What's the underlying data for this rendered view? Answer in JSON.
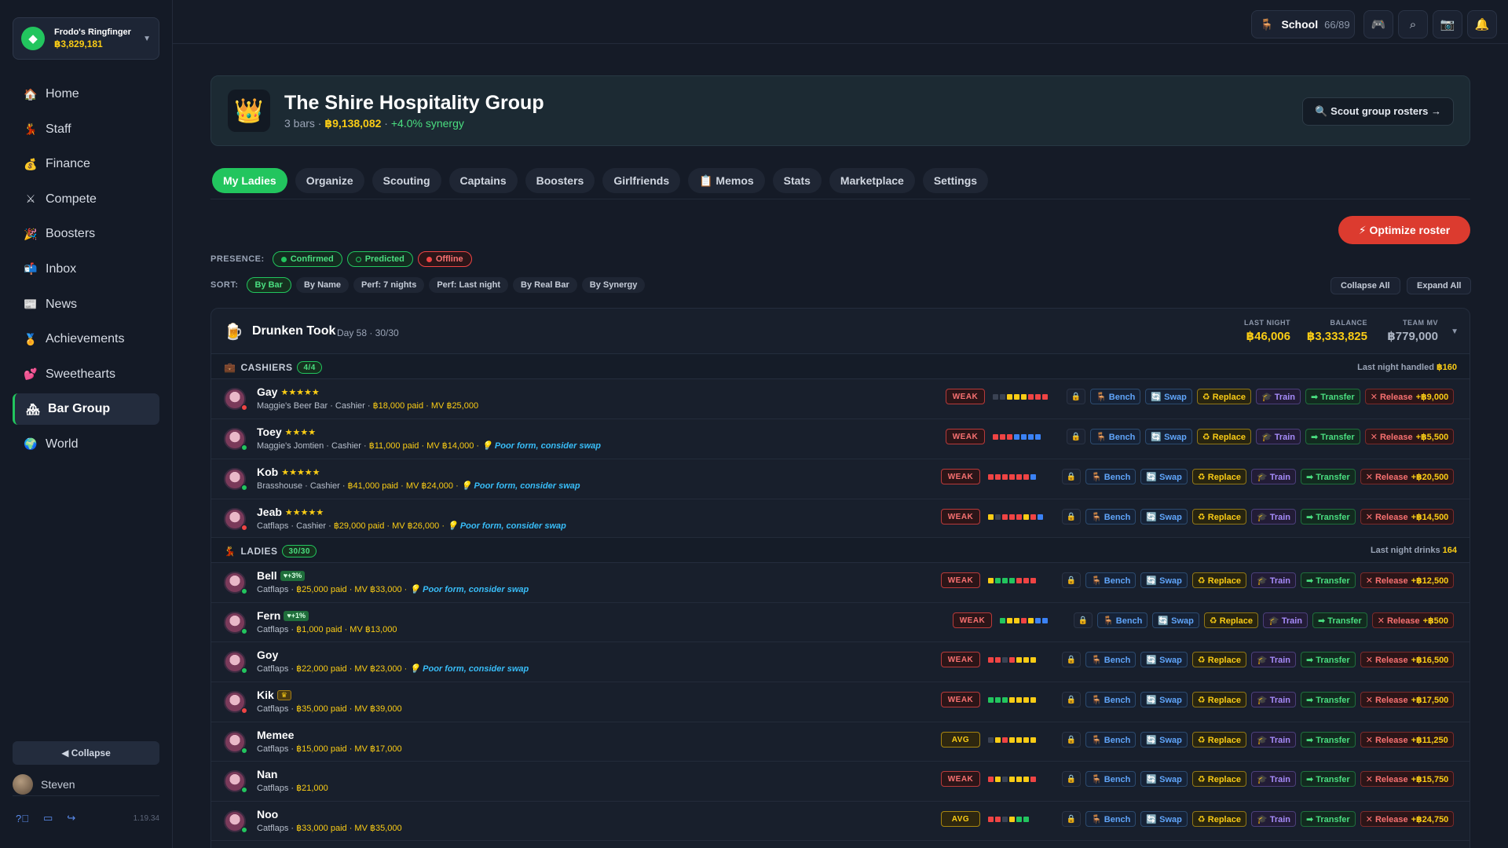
{
  "account": {
    "name": "Frodo's Ringfinger",
    "balance": "฿3,829,181"
  },
  "nav": [
    {
      "icon": "🏠",
      "label": "Home",
      "name": "home-icon"
    },
    {
      "icon": "💃",
      "label": "Staff",
      "name": "staff-icon"
    },
    {
      "icon": "💰",
      "label": "Finance",
      "name": "money-bag-icon"
    },
    {
      "icon": "⚔",
      "label": "Compete",
      "name": "swords-icon"
    },
    {
      "icon": "🎉",
      "label": "Boosters",
      "name": "party-popper-icon"
    },
    {
      "icon": "📬",
      "label": "Inbox",
      "name": "mailbox-icon"
    },
    {
      "icon": "📰",
      "label": "News",
      "name": "newspaper-icon"
    },
    {
      "icon": "🏅",
      "label": "Achievements",
      "name": "medal-icon"
    },
    {
      "icon": "💕",
      "label": "Sweethearts",
      "name": "hearts-icon"
    },
    {
      "icon": "🏘",
      "label": "Bar Group",
      "name": "houses-icon",
      "active": true
    },
    {
      "icon": "🌍",
      "label": "World",
      "name": "globe-icon"
    }
  ],
  "sidebar": {
    "collapse_label": "◀ Collapse",
    "user_name": "Steven",
    "version": "1.19.34"
  },
  "topbar": {
    "school_label": "School",
    "school_count": "66/89"
  },
  "group": {
    "title": "The Shire Hospitality Group",
    "bars_count": "3 bars",
    "balance": "฿9,138,082",
    "synergy": "+4.0% synergy",
    "scout_label": "🔍 Scout group rosters →"
  },
  "tabs": [
    "My Ladies",
    "Organize",
    "Scouting",
    "Captains",
    "Boosters",
    "Girlfriends",
    "📋 Memos",
    "Stats",
    "Marketplace",
    "Settings"
  ],
  "optimize_label": "⚡ Optimize roster",
  "presence": {
    "label": "PRESENCE:",
    "confirmed": "Confirmed",
    "predicted": "Predicted",
    "offline": "Offline"
  },
  "sort": {
    "label": "SORT:",
    "options": [
      "By Bar",
      "By Name",
      "Perf: 7 nights",
      "Perf: Last night",
      "By Real Bar",
      "By Synergy"
    ],
    "collapse_all": "Collapse All",
    "expand_all": "Expand All"
  },
  "bar": {
    "name": "Drunken Took",
    "meta": "Day 58 · 30/30",
    "last_night_label": "LAST NIGHT",
    "last_night": "฿46,006",
    "balance_label": "BALANCE",
    "balance": "฿3,333,825",
    "team_mv_label": "TEAM MV",
    "team_mv": "฿779,000"
  },
  "cashiers_section": {
    "title": "CASHIERS",
    "badge": "4/4",
    "right_label": "Last night handled",
    "right_value": "฿160"
  },
  "ladies_section": {
    "title": "LADIES",
    "badge": "30/30",
    "right_label": "Last night drinks",
    "right_value": "164"
  },
  "actions": {
    "bench": "🪑 Bench",
    "swap": "🔄 Swap",
    "replace": "♻ Replace",
    "train": "🎓 Train",
    "transfer": "➡ Transfer",
    "release": "✕ Release"
  },
  "colors": {
    "r": "#ef4444",
    "y": "#facc15",
    "g": "#22c55e",
    "b": "#3b82f6",
    "k": "#3a4253",
    "accent": "#22c55e",
    "online": "#22c55e",
    "offline": "#ef4444"
  },
  "cashiers": [
    {
      "name": "Gay",
      "stars": "★★★★★",
      "sub": "Maggie's Beer Bar · Cashier · ",
      "paid": "฿18,000 paid",
      "mv": " · MV ฿25,000",
      "tip": "",
      "form": "WEAK",
      "squares": "kkyyyrrr",
      "release": "+฿9,000",
      "status": "offline"
    },
    {
      "name": "Toey",
      "stars": "★★★★",
      "sub": "Maggie's Jomtien · Cashier · ",
      "paid": "฿11,000 paid",
      "mv": " · MV ฿14,000 · ",
      "tip": "💡 Poor form, consider swap",
      "form": "WEAK",
      "squares": "rrrbbbb",
      "release": "+฿5,500",
      "status": "online"
    },
    {
      "name": "Kob",
      "stars": "★★★★★",
      "sub": "Brasshouse · Cashier · ",
      "paid": "฿41,000 paid",
      "mv": " · MV ฿24,000 · ",
      "tip": "💡 Poor form, consider swap",
      "form": "WEAK",
      "squares": "rrrrrrb",
      "release": "+฿20,500",
      "status": "online"
    },
    {
      "name": "Jeab",
      "stars": "★★★★★",
      "sub": "Catflaps · Cashier · ",
      "paid": "฿29,000 paid",
      "mv": " · MV ฿26,000 · ",
      "tip": "💡 Poor form, consider swap",
      "form": "WEAK",
      "squares": "ykrrryrb",
      "release": "+฿14,500",
      "status": "offline"
    }
  ],
  "ladies": [
    {
      "name": "Bell",
      "tag": "♥+3%",
      "sub": "Catflaps · ",
      "paid": "฿25,000 paid",
      "mv": " · MV ฿33,000 · ",
      "tip": "💡 Poor form, consider swap",
      "form": "WEAK",
      "squares": "ygggrrr",
      "release": "+฿12,500",
      "status": "online"
    },
    {
      "name": "Fern",
      "tag": "♥+1%",
      "sub": "Catflaps · ",
      "paid": "฿1,000 paid",
      "mv": " · MV ฿13,000",
      "tip": "",
      "form": "WEAK",
      "squares": "gyyrybb",
      "release": "+฿500",
      "status": "online"
    },
    {
      "name": "Goy",
      "tag": "",
      "sub": "Catflaps · ",
      "paid": "฿22,000 paid",
      "mv": " · MV ฿23,000 · ",
      "tip": "💡 Poor form, consider swap",
      "form": "WEAK",
      "squares": "rrkryyy",
      "release": "+฿16,500",
      "status": "online"
    },
    {
      "name": "Kik",
      "tag": "♛",
      "gold": true,
      "sub": "Catflaps · ",
      "paid": "฿35,000 paid",
      "mv": " · MV ฿39,000",
      "tip": "",
      "form": "WEAK",
      "squares": "gggyyyy",
      "release": "+฿17,500",
      "status": "offline"
    },
    {
      "name": "Memee",
      "tag": "",
      "sub": "Catflaps · ",
      "paid": "฿15,000 paid",
      "mv": " · MV ฿17,000",
      "tip": "",
      "form": "AVG",
      "squares": "kyryyyy",
      "release": "+฿11,250",
      "status": "online"
    },
    {
      "name": "Nan",
      "tag": "",
      "sub": "Catflaps · ",
      "paid": "฿21,000",
      "mv": "",
      "tip": "",
      "form": "WEAK",
      "squares": "rykyyyr",
      "release": "+฿15,750",
      "status": "online"
    },
    {
      "name": "Noo",
      "tag": "",
      "sub": "Catflaps · ",
      "paid": "฿33,000 paid",
      "mv": " · MV ฿35,000",
      "tip": "",
      "form": "AVG",
      "squares": "rrkygg",
      "release": "+฿24,750",
      "status": "online"
    }
  ]
}
